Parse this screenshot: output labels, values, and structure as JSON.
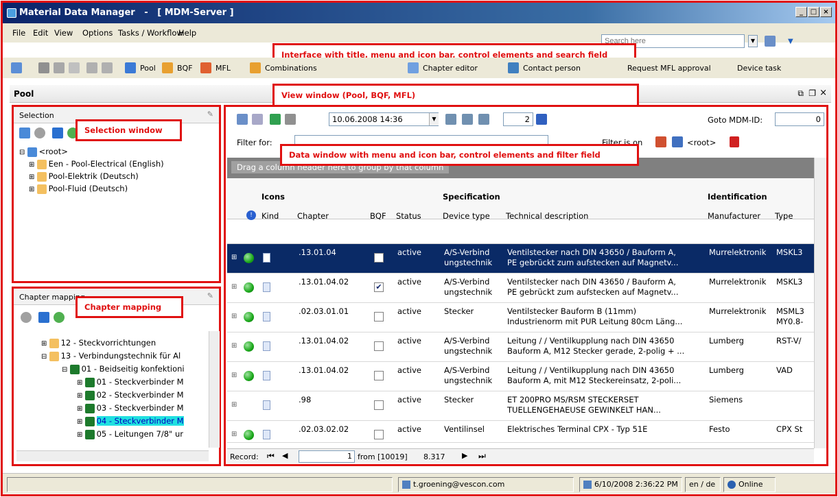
{
  "window": {
    "title": "Material Data Manager   -   [ MDM-Server ]"
  },
  "menu": [
    "File",
    "Edit",
    "View",
    "Options",
    "Tasks / Workflow",
    "Help"
  ],
  "search": {
    "placeholder": "Search here"
  },
  "toolbar": {
    "items": [
      "Pool",
      "BQF",
      "MFL",
      "Combinations",
      "Chapter editor",
      "Contact person"
    ],
    "request": "Request MFL approval",
    "device_task": "Device task"
  },
  "annotations": {
    "interface": "Interface with title, menu and icon bar, control elements and search field",
    "view": "View window (Pool, BQF, MFL)",
    "selection": "Selection window",
    "data": "Data window with  menu and icon bar, control elements and filter field",
    "chapter": "Chapter mapping"
  },
  "pool": {
    "title": "Pool"
  },
  "selection": {
    "title": "Selection",
    "tree": {
      "root": "<root>",
      "children": [
        "Een - Pool-Electrical (English)",
        "Pool-Elektrik (Deutsch)",
        "Pool-Fluid (Deutsch)"
      ]
    }
  },
  "chapter": {
    "title": "Chapter mapping",
    "items": [
      "12 - Steckvorrichtungen",
      "13 - Verbindungstechnik für Al",
      "01 - Beidseitig konfektioni",
      "01 - Steckverbinder M",
      "02 - Steckverbinder M",
      "03 - Steckverbinder M",
      "04 - Steckverbinder M",
      "05 - Leitungen 7/8\" ur"
    ]
  },
  "datawin": {
    "date": "10.06.2008 14:36",
    "page": "2",
    "goto_label": "Goto MDM-ID:",
    "goto_value": "0",
    "filter_label": "Filter for:",
    "filter_active": "Filter is on",
    "root_label": "<root>",
    "group_hint": "Drag a column header here to group by that column"
  },
  "grid": {
    "bands": [
      "Icons",
      "Specification",
      "Identification"
    ],
    "columns": [
      "Kind",
      "Chapter",
      "BQF",
      "Status",
      "Device type",
      "Technical description",
      "Manufacturer",
      "Type"
    ],
    "rows": [
      {
        "chapter": ".13.01.04",
        "bqf": false,
        "status": "active",
        "device": "A/S-Verbind ungstechnik",
        "desc1": "Ventilstecker nach DIN 43650 / Bauform A,",
        "desc2": "PE gebrückt zum aufstecken auf Magnetv...",
        "manu": "Murrelektronik",
        "type": "MSKL3",
        "dot": true,
        "selected": true
      },
      {
        "chapter": ".13.01.04.02",
        "bqf": true,
        "status": "active",
        "device": "A/S-Verbind ungstechnik",
        "desc1": "Ventilstecker nach DIN 43650 / Bauform A,",
        "desc2": "PE gebrückt zum aufstecken auf Magnetv...",
        "manu": "Murrelektronik",
        "type": "MSKL3",
        "dot": true,
        "selected": false
      },
      {
        "chapter": ".02.03.01.01",
        "bqf": false,
        "status": "active",
        "device": "Stecker",
        "desc1": "Ventilstecker Bauform B (11mm)",
        "desc2": "Industrienorm mit PUR Leitung 80cm Läng...",
        "manu": "Murrelektronik",
        "type": "MSML3 MY0.8-",
        "dot": true,
        "selected": false
      },
      {
        "chapter": ".13.01.04.02",
        "bqf": false,
        "status": "active",
        "device": "A/S-Verbind ungstechnik",
        "desc1": "Leitung /  / Ventilkupplung nach DIN 43650",
        "desc2": "Bauform A, M12 Stecker gerade, 2-polig + ...",
        "manu": "Lumberg",
        "type": "RST-V/",
        "dot": true,
        "selected": false
      },
      {
        "chapter": ".13.01.04.02",
        "bqf": false,
        "status": "active",
        "device": "A/S-Verbind ungstechnik",
        "desc1": "Leitung /  / Ventilkupplung nach DIN 43650",
        "desc2": "Bauform A, mit M12 Steckereinsatz, 2-poli...",
        "manu": "Lumberg",
        "type": "VAD",
        "dot": true,
        "selected": false
      },
      {
        "chapter": ".98",
        "bqf": false,
        "status": "active",
        "device": "Stecker",
        "desc1": "ET 200PRO MS/RSM STECKERSET",
        "desc2": "TUELLENGEHAEUSE GEWINKELT HAN...",
        "manu": "Siemens",
        "type": "",
        "dot": false,
        "selected": false
      },
      {
        "chapter": ".02.03.02.02",
        "bqf": false,
        "status": "active",
        "device": "Ventilinsel",
        "desc1": "Elektrisches Terminal CPX - Typ 51E",
        "desc2": "",
        "manu": "Festo",
        "type": "CPX St",
        "dot": true,
        "selected": false
      }
    ]
  },
  "pager": {
    "label": "Record:",
    "current": "1",
    "from": "from [10019]",
    "count": "8.317"
  },
  "statusbar": {
    "user": "t.groening@vescon.com",
    "time": "6/10/2008 2:36:22 PM",
    "lang": "en / de",
    "online": "Online"
  }
}
